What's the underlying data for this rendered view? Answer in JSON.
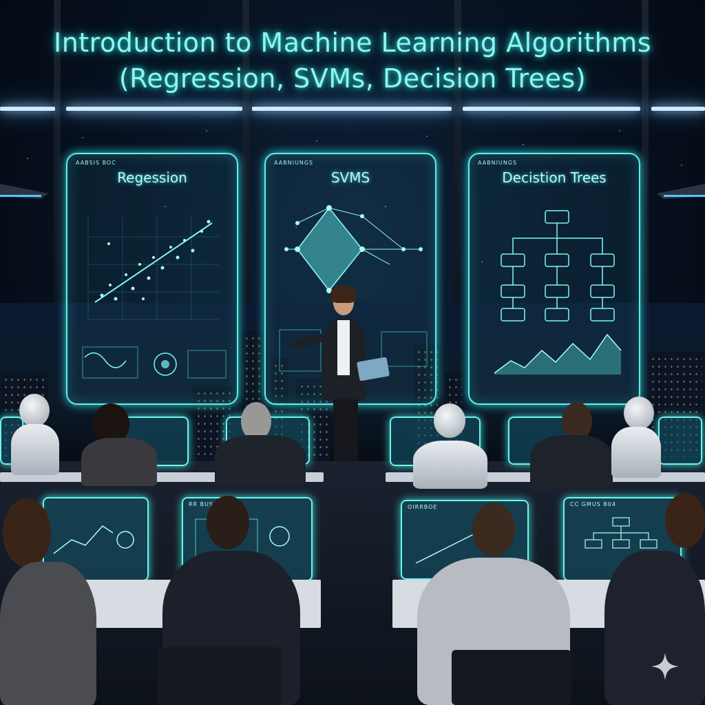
{
  "title": {
    "line1": "Introduction to Machine Learning Algorithms",
    "line2": "(Regression, SVMs, Decision Trees)"
  },
  "panels": [
    {
      "tag": "AABSIS BOC",
      "heading": "Regession"
    },
    {
      "tag": "AABNIUNGS",
      "heading": "SVMS"
    },
    {
      "tag": "AABNIUNGS",
      "heading": "Decistion Trees"
    }
  ],
  "monitors": [
    {
      "tag": "RR BUS"
    },
    {
      "tag": "OIRRBOE"
    },
    {
      "tag": "CC GMUS B04"
    }
  ],
  "colors": {
    "hologram": "#5ff0ea",
    "title_glow": "#8ff6ee",
    "light_bar": "#cfeaff",
    "background": "#050a14"
  },
  "icons": {
    "corner_mark": "sparkle-icon"
  }
}
